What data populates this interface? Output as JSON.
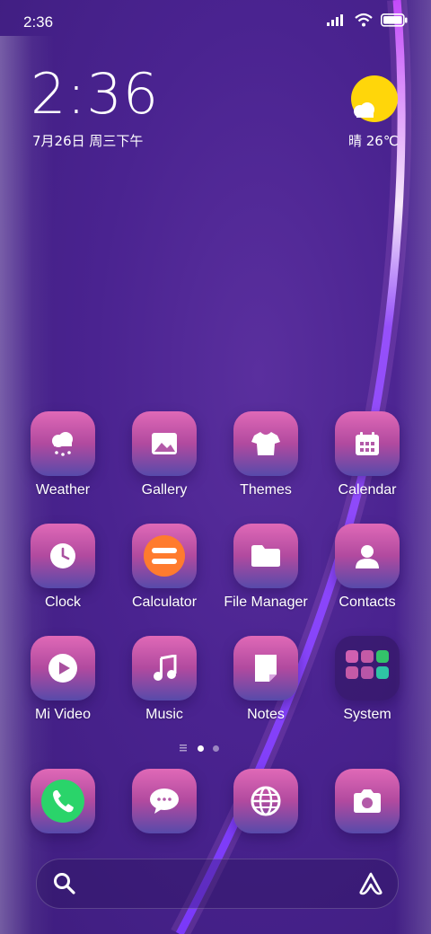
{
  "status_bar": {
    "time": "2:36",
    "icons": [
      "signal-icon",
      "wifi-icon",
      "battery-icon"
    ]
  },
  "clock_widget": {
    "time": "2:36",
    "date": "7月26日 周三下午"
  },
  "weather_widget": {
    "condition_temp": "晴 26℃",
    "icon": "sun-cloud-icon"
  },
  "apps": [
    {
      "label": "Weather",
      "icon": "weather-icon"
    },
    {
      "label": "Gallery",
      "icon": "gallery-icon"
    },
    {
      "label": "Themes",
      "icon": "themes-icon"
    },
    {
      "label": "Calendar",
      "icon": "calendar-icon"
    },
    {
      "label": "Clock",
      "icon": "clock-icon"
    },
    {
      "label": "Calculator",
      "icon": "calculator-icon"
    },
    {
      "label": "File Manager",
      "icon": "folder-icon"
    },
    {
      "label": "Contacts",
      "icon": "contacts-icon"
    },
    {
      "label": "Mi Video",
      "icon": "play-icon"
    },
    {
      "label": "Music",
      "icon": "music-icon"
    },
    {
      "label": "Notes",
      "icon": "notes-icon"
    },
    {
      "label": "System",
      "icon": "folder-icon"
    }
  ],
  "dock": [
    {
      "icon": "phone-icon"
    },
    {
      "icon": "messages-icon"
    },
    {
      "icon": "browser-icon"
    },
    {
      "icon": "camera-icon"
    }
  ],
  "page_indicator": {
    "pages": 2,
    "current": 1
  },
  "search_bar": {
    "left_icon": "search-icon",
    "right_icon": "assistant-icon"
  },
  "colors": {
    "accent_tile_top": "#e069b7",
    "accent_tile_bottom": "#574aaa",
    "sun": "#ffd60a",
    "phone_green": "#2ad46a",
    "calculator_orange": "#ff7b2e"
  }
}
